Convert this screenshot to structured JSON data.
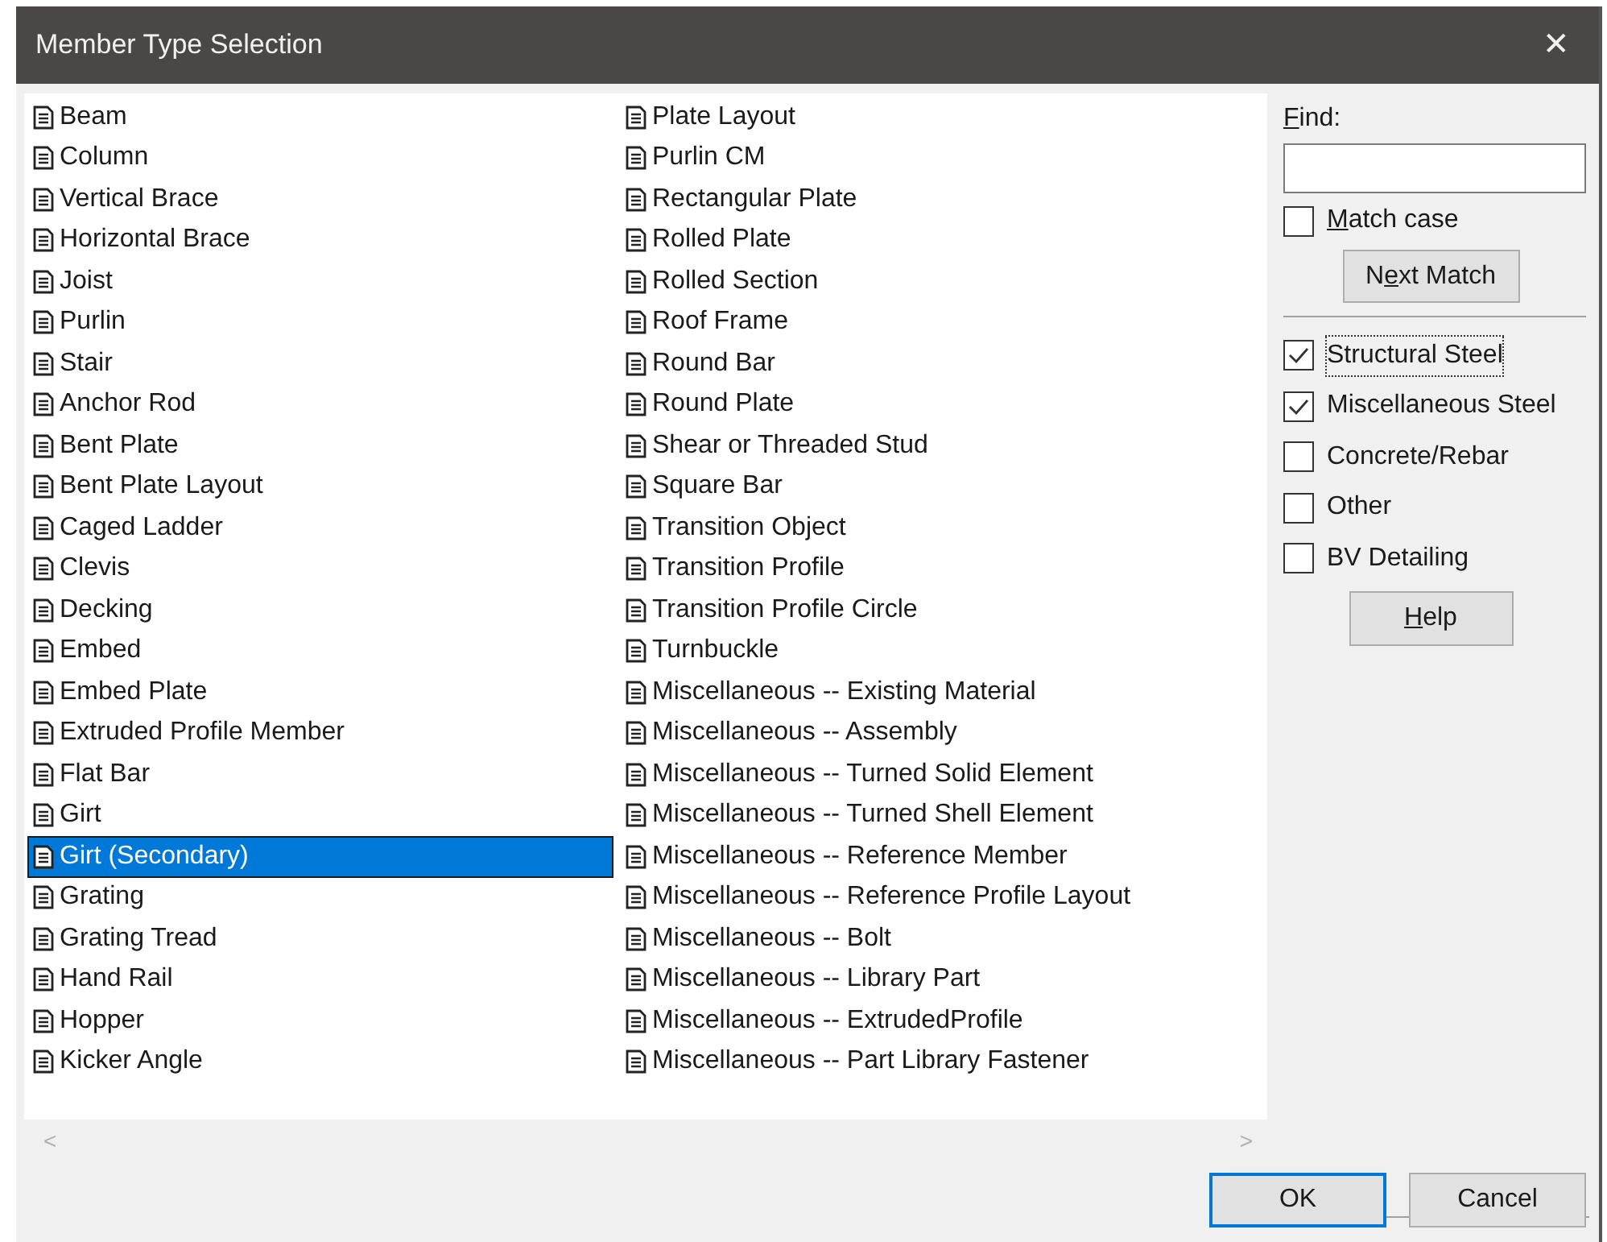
{
  "window": {
    "title": "Member Type Selection",
    "close": "✕"
  },
  "list": {
    "columns": [
      {
        "items": [
          {
            "label": "Beam",
            "selected": false
          },
          {
            "label": "Column",
            "selected": false
          },
          {
            "label": "Vertical Brace",
            "selected": false
          },
          {
            "label": "Horizontal Brace",
            "selected": false
          },
          {
            "label": "Joist",
            "selected": false
          },
          {
            "label": "Purlin",
            "selected": false
          },
          {
            "label": "Stair",
            "selected": false
          },
          {
            "label": "Anchor Rod",
            "selected": false
          },
          {
            "label": "Bent Plate",
            "selected": false
          },
          {
            "label": "Bent Plate Layout",
            "selected": false
          },
          {
            "label": "Caged Ladder",
            "selected": false
          },
          {
            "label": "Clevis",
            "selected": false
          },
          {
            "label": "Decking",
            "selected": false
          },
          {
            "label": "Embed",
            "selected": false
          },
          {
            "label": "Embed Plate",
            "selected": false
          },
          {
            "label": "Extruded Profile Member",
            "selected": false
          },
          {
            "label": "Flat Bar",
            "selected": false
          },
          {
            "label": "Girt",
            "selected": false
          },
          {
            "label": "Girt (Secondary)",
            "selected": true
          },
          {
            "label": "Grating",
            "selected": false
          },
          {
            "label": "Grating Tread",
            "selected": false
          },
          {
            "label": "Hand Rail",
            "selected": false
          },
          {
            "label": "Hopper",
            "selected": false
          },
          {
            "label": "Kicker Angle",
            "selected": false
          }
        ]
      },
      {
        "items": [
          {
            "label": "Plate Layout",
            "selected": false
          },
          {
            "label": "Purlin CM",
            "selected": false
          },
          {
            "label": "Rectangular Plate",
            "selected": false
          },
          {
            "label": "Rolled Plate",
            "selected": false
          },
          {
            "label": "Rolled Section",
            "selected": false
          },
          {
            "label": "Roof Frame",
            "selected": false
          },
          {
            "label": "Round Bar",
            "selected": false
          },
          {
            "label": "Round Plate",
            "selected": false
          },
          {
            "label": "Shear or Threaded Stud",
            "selected": false
          },
          {
            "label": "Square Bar",
            "selected": false
          },
          {
            "label": "Transition Object",
            "selected": false
          },
          {
            "label": "Transition Profile",
            "selected": false
          },
          {
            "label": "Transition Profile Circle",
            "selected": false
          },
          {
            "label": "Turnbuckle",
            "selected": false
          },
          {
            "label": "Miscellaneous -- Existing Material",
            "selected": false
          },
          {
            "label": "Miscellaneous -- Assembly",
            "selected": false
          },
          {
            "label": "Miscellaneous -- Turned Solid Element",
            "selected": false
          },
          {
            "label": "Miscellaneous -- Turned Shell Element",
            "selected": false
          },
          {
            "label": "Miscellaneous -- Reference Member",
            "selected": false
          },
          {
            "label": "Miscellaneous -- Reference Profile Layout",
            "selected": false
          },
          {
            "label": "Miscellaneous -- Bolt",
            "selected": false
          },
          {
            "label": "Miscellaneous -- Library Part",
            "selected": false
          },
          {
            "label": "Miscellaneous -- ExtrudedProfile",
            "selected": false
          },
          {
            "label": "Miscellaneous -- Part Library Fastener",
            "selected": false
          }
        ]
      }
    ],
    "scroll_left": "<",
    "scroll_right": ">"
  },
  "find": {
    "label": {
      "key": "F",
      "after": "ind:"
    }
  },
  "match_case": {
    "label": {
      "key": "M",
      "after": "atch case"
    },
    "checked": false
  },
  "next_match": {
    "label": {
      "before": "N",
      "key": "e",
      "after": "xt Match"
    }
  },
  "filters": [
    {
      "label": "Structural Steel",
      "checked": true,
      "focused": true
    },
    {
      "label": "Miscellaneous Steel",
      "checked": true,
      "focused": false
    },
    {
      "label": "Concrete/Rebar",
      "checked": false,
      "focused": false
    },
    {
      "label": "Other",
      "checked": false,
      "focused": false
    },
    {
      "label": "BV Detailing",
      "checked": false,
      "focused": false
    }
  ],
  "help": {
    "label": {
      "key": "H",
      "after": "elp"
    }
  },
  "buttons": [
    {
      "label": "OK",
      "default": true
    },
    {
      "label": "Cancel",
      "default": false
    }
  ]
}
